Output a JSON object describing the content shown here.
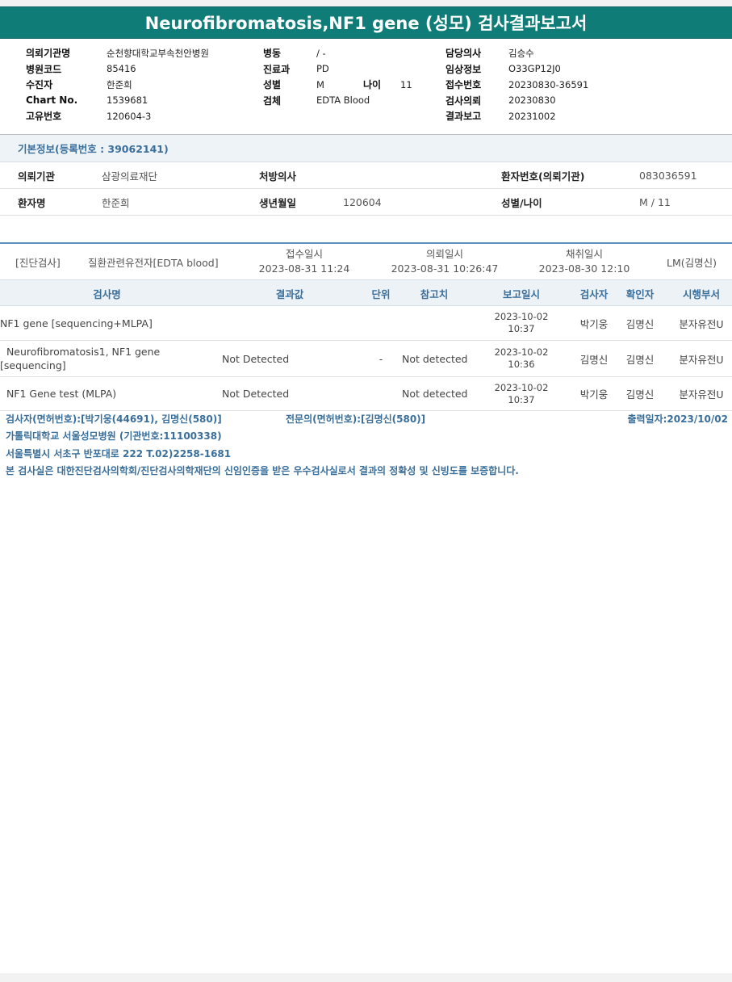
{
  "report": {
    "title": "Neurofibromatosis,NF1 gene (성모) 검사결과보고서"
  },
  "header": {
    "col1": [
      {
        "label": "의뢰기관명",
        "value": "순천향대학교부속천안병원"
      },
      {
        "label": "병원코드",
        "value": "85416"
      },
      {
        "label": "수진자",
        "value": "한준희"
      },
      {
        "label": "Chart No.",
        "value": "1539681"
      },
      {
        "label": "고유번호",
        "value": "120604-3"
      }
    ],
    "col2": [
      {
        "label": "병동",
        "value": "/ -"
      },
      {
        "label": "진료과",
        "value": "PD"
      },
      {
        "label": "성별",
        "value": "M"
      },
      {
        "label": "검체",
        "value": "EDTA Blood"
      }
    ],
    "age": {
      "label": "나이",
      "value": "11"
    },
    "col3": [
      {
        "label": "담당의사",
        "value": "김승수"
      },
      {
        "label": "임상정보",
        "value": "O33GP12J0"
      },
      {
        "label": "접수번호",
        "value": "20230830-36591"
      },
      {
        "label": "검사의뢰",
        "value": "20230830"
      },
      {
        "label": "결과보고",
        "value": "20231002"
      }
    ]
  },
  "basic_info": {
    "title": "기본정보(등록번호 : 39062141)",
    "row1": {
      "inst_label": "의뢰기관",
      "inst_value": "삼광의료재단",
      "doctor_label": "처방의사",
      "doctor_value": "",
      "patno_label": "환자번호(의뢰기관)",
      "patno_value": "083036591"
    },
    "row2": {
      "name_label": "환자명",
      "name_value": "한준희",
      "birth_label": "생년월일",
      "birth_value": "120604",
      "sexage_label": "성별/나이",
      "sexage_value": "M / 11"
    }
  },
  "order": {
    "category": "[진단검사]",
    "test": "질환관련유전자[EDTA blood]",
    "receipt_label": "접수일시",
    "receipt_value": "2023-08-31 11:24",
    "request_label": "의뢰일시",
    "request_value": "2023-08-31 10:26:47",
    "collect_label": "채취일시",
    "collect_value": "2023-08-30 12:10",
    "lab": "LM(김명신)"
  },
  "table": {
    "headers": {
      "name": "검사명",
      "result": "결과값",
      "unit": "단위",
      "ref": "참고치",
      "date": "보고일시",
      "tester": "검사자",
      "checker": "확인자",
      "dept": "시행부서"
    },
    "rows": [
      {
        "name": "NF1 gene [sequencing+MLPA]",
        "result": "",
        "unit": "",
        "ref": "",
        "date1": "2023-10-02",
        "date2": "10:37",
        "tester": "박기웅",
        "checker": "김명신",
        "dept": "분자유전U"
      },
      {
        "name": "  Neurofibromatosis1, NF1 gene [sequencing]",
        "result": "Not Detected",
        "unit": "-",
        "ref": "Not detected",
        "date1": "2023-10-02",
        "date2": "10:36",
        "tester": "김명신",
        "checker": "김명신",
        "dept": "분자유전U"
      },
      {
        "name": "  NF1 Gene test (MLPA)",
        "result": "Not Detected",
        "unit": "",
        "ref": "Not detected",
        "date1": "2023-10-02",
        "date2": "10:37",
        "tester": "박기웅",
        "checker": "김명신",
        "dept": "분자유전U"
      }
    ]
  },
  "footer": {
    "examiner": "검사자(면허번호):[박기웅(44691), 김명신(580)]",
    "specialist": "전문의(면허번호):[김명신(580)]",
    "print_date": "출력일자:2023/10/02",
    "hospital": "가톨릭대학교 서울성모병원 (기관번호:11100338)",
    "address": "서울특별시 서초구 반포대로 222 T.02)2258-1681",
    "certification": "본 검사실은 대한진단검사의학회/진단검사의학재단의 신임인증을 받은 우수검사실로서 결과의 정확성 및 신빙도를 보증합니다."
  }
}
